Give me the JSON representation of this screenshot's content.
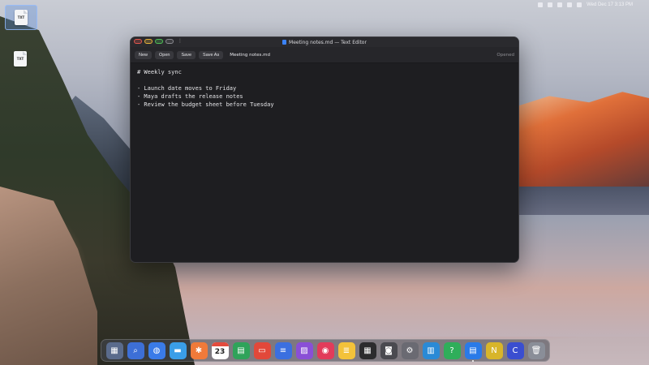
{
  "menubar": {
    "clock": "Wed Dec 17  3:13 PM",
    "tray_icons": [
      "battery-icon",
      "volume-icon",
      "wifi-icon",
      "bluetooth-icon",
      "control-center-icon"
    ]
  },
  "desktop": {
    "icons": [
      {
        "name": "desktop-file-1",
        "badge": "TXT",
        "label": "",
        "selected": true
      },
      {
        "name": "desktop-file-2",
        "badge": "TXT",
        "label": "",
        "selected": false
      }
    ]
  },
  "window": {
    "title": "Meeting notes.md — Text Editor",
    "toolbar": {
      "new": "New",
      "open": "Open",
      "save": "Save",
      "save_as": "Save As",
      "filename": "Meeting notes.md",
      "status": "Opened"
    },
    "document_lines": [
      "# Weekly sync",
      "",
      "- Launch date moves to Friday",
      "- Maya drafts the release notes",
      "- Review the budget sheet before Tuesday"
    ]
  },
  "dock": {
    "calendar_day": "23",
    "apps": [
      {
        "name": "launchpad-icon",
        "color": "#5a6b8c",
        "glyph": "▦"
      },
      {
        "name": "finder-search-icon",
        "color": "#3d6fd6",
        "glyph": "⌕"
      },
      {
        "name": "browser-icon",
        "color": "#3a7be8",
        "glyph": "◍"
      },
      {
        "name": "files-icon",
        "color": "#3a9ee8",
        "glyph": "▬"
      },
      {
        "name": "photos-pinwheel-icon",
        "color": "#f07a3a",
        "glyph": "✱"
      },
      {
        "name": "calendar-icon",
        "color": "#ffffff",
        "glyph": ""
      },
      {
        "name": "spreadsheet-icon",
        "color": "#2fa35a",
        "glyph": "▤"
      },
      {
        "name": "presentation-icon",
        "color": "#e2483a",
        "glyph": "▭"
      },
      {
        "name": "document-icon",
        "color": "#3b6fe0",
        "glyph": "≡"
      },
      {
        "name": "image-viewer-icon",
        "color": "#8a4fd6",
        "glyph": "▨"
      },
      {
        "name": "media-player-icon",
        "color": "#e23b5a",
        "glyph": "◉"
      },
      {
        "name": "notes-icon",
        "color": "#f3c23a",
        "glyph": "≣"
      },
      {
        "name": "calculator-icon",
        "color": "#2c2c2e",
        "glyph": "▦"
      },
      {
        "name": "camera-icon",
        "color": "#4a4a50",
        "glyph": "◙"
      },
      {
        "name": "settings-gear-icon",
        "color": "#6a6a72",
        "glyph": "⚙"
      },
      {
        "name": "system-monitor-icon",
        "color": "#2a8ad6",
        "glyph": "▥"
      },
      {
        "name": "help-chat-icon",
        "color": "#2fae5a",
        "glyph": "?"
      },
      {
        "name": "text-editor-icon",
        "color": "#2a7ae8",
        "glyph": "▤",
        "running": true
      },
      {
        "name": "notes-n-icon",
        "color": "#d8b52a",
        "glyph": "N"
      },
      {
        "name": "code-c-icon",
        "color": "#3a4ed0",
        "glyph": "C"
      },
      {
        "name": "trash-icon",
        "color": "#8a8e98",
        "glyph": "🗑"
      }
    ]
  }
}
